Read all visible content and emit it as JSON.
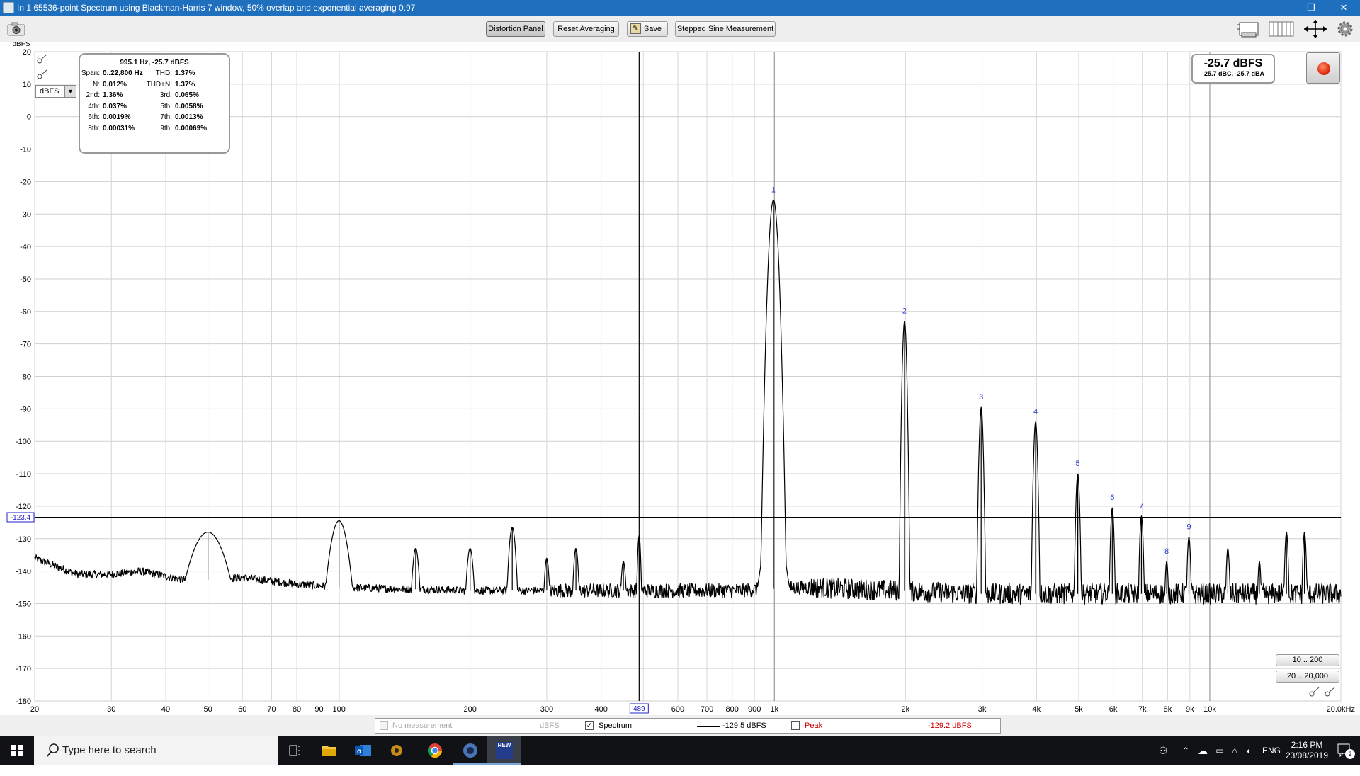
{
  "window": {
    "title": "In 1 65536-point Spectrum using Blackman-Harris 7 window, 50% overlap and exponential averaging 0.97",
    "minimize": "–",
    "maximize": "❐",
    "close": "✕"
  },
  "toolbar": {
    "distortion_panel": "Distortion Panel",
    "reset_averaging": "Reset Averaging",
    "save": "Save",
    "stepped_sine": "Stepped Sine Measurement",
    "icons": [
      "camera-icon",
      "layout-icon",
      "columns-icon",
      "move-arrows-icon",
      "gear-icon"
    ]
  },
  "distortion": {
    "header": "995.1 Hz, -25.7 dBFS",
    "rows": [
      [
        {
          "k": "Span:",
          "v": "0..22,800 Hz"
        },
        {
          "k": "THD:",
          "v": "1.37%"
        }
      ],
      [
        {
          "k": "N:",
          "v": "0.012%"
        },
        {
          "k": "THD+N:",
          "v": "1.37%"
        }
      ],
      [
        {
          "k": "2nd:",
          "v": "1.36%"
        },
        {
          "k": "3rd:",
          "v": "0.065%"
        }
      ],
      [
        {
          "k": "4th:",
          "v": "0.037%"
        },
        {
          "k": "5th:",
          "v": "0.0058%"
        }
      ],
      [
        {
          "k": "6th:",
          "v": "0.0019%"
        },
        {
          "k": "7th:",
          "v": "0.0013%"
        }
      ],
      [
        {
          "k": "8th:",
          "v": "0.00031%"
        },
        {
          "k": "9th:",
          "v": "0.00069%"
        }
      ]
    ]
  },
  "level_meter": {
    "main": "-25.7 dBFS",
    "sub": "-25.7 dBC, -25.7 dBA"
  },
  "unit_select": "dBFS",
  "axis_unit": "dBFS",
  "cursor": {
    "y_value": "-123.4",
    "x_value": "489",
    "x_freq": 489
  },
  "range_buttons": [
    "10 .. 200",
    "20 .. 20,000"
  ],
  "legend": {
    "no_measurement": "No measurement",
    "no_measurement_unit": "dBFS",
    "spectrum": "Spectrum",
    "spectrum_value": "-129.5 dBFS",
    "peak": "Peak",
    "peak_value": "-129.2 dBFS",
    "spectrum_checked": true,
    "peak_checked": false
  },
  "chart_data": {
    "type": "line",
    "xscale": "log",
    "xlim": [
      20,
      20000
    ],
    "ylim": [
      -180,
      20
    ],
    "y_ticks": [
      20,
      10,
      0,
      -10,
      -20,
      -30,
      -40,
      -50,
      -60,
      -70,
      -80,
      -90,
      -100,
      -110,
      -120,
      -130,
      -140,
      -150,
      -160,
      -170,
      -180
    ],
    "x_ticks": [
      {
        "f": 20,
        "label": "20"
      },
      {
        "f": 30,
        "label": "30"
      },
      {
        "f": 40,
        "label": "40"
      },
      {
        "f": 50,
        "label": "50"
      },
      {
        "f": 60,
        "label": "60"
      },
      {
        "f": 70,
        "label": "70"
      },
      {
        "f": 80,
        "label": "80"
      },
      {
        "f": 90,
        "label": "90"
      },
      {
        "f": 100,
        "label": "100"
      },
      {
        "f": 200,
        "label": "200"
      },
      {
        "f": 300,
        "label": "300"
      },
      {
        "f": 400,
        "label": "400"
      },
      {
        "f": 600,
        "label": "600"
      },
      {
        "f": 700,
        "label": "700"
      },
      {
        "f": 800,
        "label": "800"
      },
      {
        "f": 900,
        "label": "900"
      },
      {
        "f": 1000,
        "label": "1k"
      },
      {
        "f": 2000,
        "label": "2k"
      },
      {
        "f": 3000,
        "label": "3k"
      },
      {
        "f": 4000,
        "label": "4k"
      },
      {
        "f": 5000,
        "label": "5k"
      },
      {
        "f": 6000,
        "label": "6k"
      },
      {
        "f": 7000,
        "label": "7k"
      },
      {
        "f": 8000,
        "label": "8k"
      },
      {
        "f": 9000,
        "label": "9k"
      },
      {
        "f": 10000,
        "label": "10k"
      },
      {
        "f": 20000,
        "label": "20.0kHz"
      }
    ],
    "series": [
      {
        "color": "#000000",
        "noise_floor": [
          [
            20,
            -136
          ],
          [
            25,
            -141
          ],
          [
            30,
            -141
          ],
          [
            35,
            -140
          ],
          [
            45,
            -143
          ],
          [
            60,
            -142
          ],
          [
            80,
            -144
          ],
          [
            100,
            -145
          ],
          [
            200,
            -146
          ],
          [
            400,
            -146
          ],
          [
            800,
            -146
          ],
          [
            1200,
            -145
          ],
          [
            3000,
            -147
          ],
          [
            10000,
            -147
          ],
          [
            20000,
            -147
          ]
        ],
        "peaks": [
          {
            "f": 50,
            "db": -128,
            "w": 0.02
          },
          {
            "f": 100,
            "db": -124.5,
            "w": 0.01
          },
          {
            "f": 150,
            "db": -133,
            "w": 0.004
          },
          {
            "f": 200,
            "db": -133,
            "w": 0.004
          },
          {
            "f": 250,
            "db": -126.5,
            "w": 0.004
          },
          {
            "f": 300,
            "db": -136,
            "w": 0.003
          },
          {
            "f": 350,
            "db": -133,
            "w": 0.003
          },
          {
            "f": 450,
            "db": -137,
            "w": 0.003
          },
          {
            "f": 489,
            "db": -129,
            "w": 0.002
          },
          {
            "f": 995.1,
            "db": -25.7,
            "w": 0.004
          },
          {
            "f": 1990,
            "db": -63,
            "w": 0.002
          },
          {
            "f": 2985,
            "db": -89.5,
            "w": 0.002
          },
          {
            "f": 3980,
            "db": -94,
            "w": 0.002
          },
          {
            "f": 4975,
            "db": -110,
            "w": 0.002
          },
          {
            "f": 5970,
            "db": -120.5,
            "w": 0.002
          },
          {
            "f": 6965,
            "db": -123,
            "w": 0.002
          },
          {
            "f": 7960,
            "db": -137,
            "w": 0.002
          },
          {
            "f": 8955,
            "db": -129.5,
            "w": 0.002
          },
          {
            "f": 11000,
            "db": -133,
            "w": 0.002
          },
          {
            "f": 13000,
            "db": -137,
            "w": 0.002
          },
          {
            "f": 15000,
            "db": -128,
            "w": 0.002
          },
          {
            "f": 16500,
            "db": -128,
            "w": 0.002
          }
        ]
      }
    ],
    "harmonic_markers": [
      {
        "label": "1",
        "f": 995.1,
        "db": -25.7
      },
      {
        "label": "2",
        "f": 1990,
        "db": -63
      },
      {
        "label": "3",
        "f": 2985,
        "db": -89.5
      },
      {
        "label": "4",
        "f": 3980,
        "db": -94
      },
      {
        "label": "5",
        "f": 4975,
        "db": -110
      },
      {
        "label": "6",
        "f": 5970,
        "db": -120.5
      },
      {
        "label": "7",
        "f": 6965,
        "db": -123
      },
      {
        "label": "8",
        "f": 7960,
        "db": -137
      },
      {
        "label": "9",
        "f": 8955,
        "db": -129.5
      }
    ]
  },
  "taskbar": {
    "search_placeholder": "Type here to search",
    "apps": [
      "task-view-icon",
      "file-explorer-icon",
      "outlook-icon",
      "app-icon",
      "chrome-icon",
      "app2-icon",
      "rew-icon"
    ],
    "rew_label": "REW",
    "lang": "ENG",
    "time": "2:16 PM",
    "date": "23/08/2019",
    "notif_count": "2"
  }
}
